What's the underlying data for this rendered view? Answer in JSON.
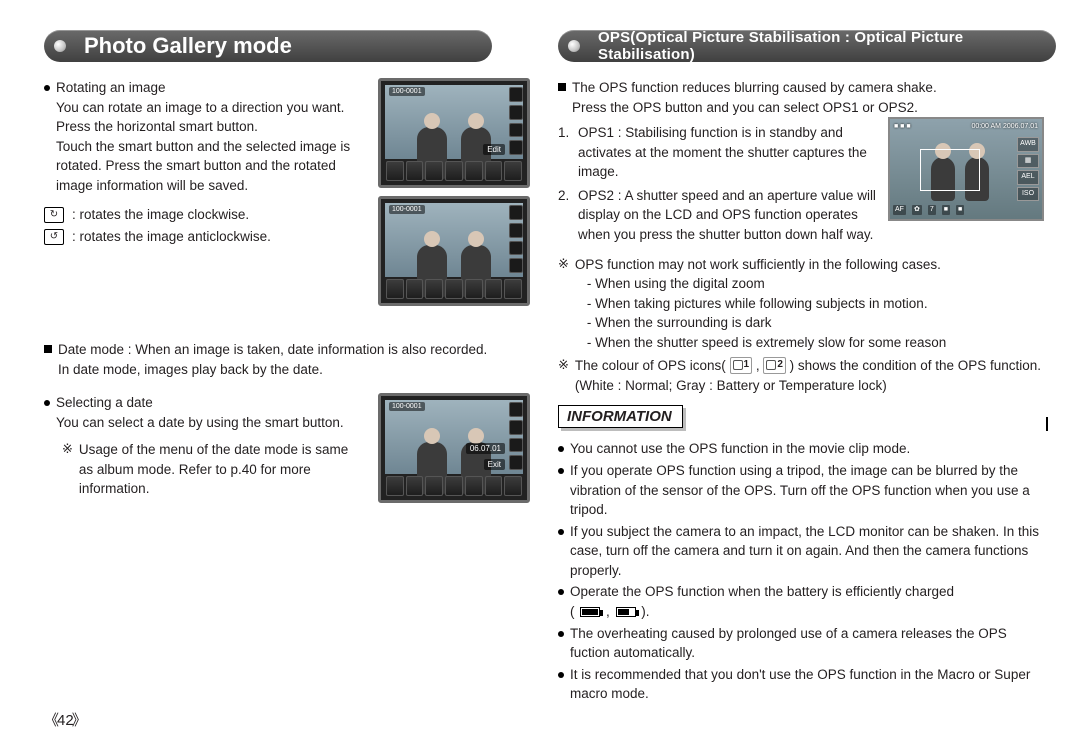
{
  "page_number": "42",
  "left": {
    "header": "Photo Gallery mode",
    "rotating": {
      "title": "Rotating an image",
      "p1": "You can rotate an image to a direction you want.",
      "p2": "Press the horizontal smart button.",
      "p3": "Touch the smart button and the selected image is rotated. Press the smart button and the rotated image information will be saved.",
      "cw": ": rotates the image clockwise.",
      "ccw": ": rotates the image anticlockwise."
    },
    "datemode": {
      "line": "Date mode : When an image is taken, date information is also recorded.",
      "line2": "In date mode, images play back by the date."
    },
    "selecting": {
      "title": "Selecting a date",
      "p1": "You can select a date by using the smart button.",
      "note": "Usage of the menu of the date mode is same as album mode. Refer to p.40 for more information."
    },
    "thumb": {
      "folder": "100-0001",
      "edit": "Edit",
      "date": "06.07.01",
      "exit": "Exit"
    }
  },
  "right": {
    "header": "OPS(Optical Picture Stabilisation : Optical Picture Stabilisation)",
    "intro1": "The OPS function reduces blurring caused by camera shake.",
    "intro2": "Press the OPS button and you can select OPS1 or OPS2.",
    "ops1_num": "1.",
    "ops1": "OPS1 : Stabilising function is in standby and activates at the moment the shutter captures the image.",
    "ops2_num": "2.",
    "ops2": "OPS2 : A shutter speed and an aperture value will display on the LCD and OPS function operates when you press the shutter button down half way.",
    "star1": "OPS function may not work sufficiently in the following cases.",
    "cases": [
      "When using the digital zoom",
      "When taking pictures while following subjects in motion.",
      "When the surrounding is dark",
      "When the shutter speed is extremely slow for some reason"
    ],
    "star2a": "The colour of OPS icons(",
    "star2b": ") shows the condition of the OPS function. (White : Normal; Gray : Battery or Temperature lock)",
    "osd": {
      "time": "00:00 AM 2006.07.01",
      "awb": "AWB",
      "ael": "AEL",
      "af": "AF",
      "iso": "ISO",
      "num": "7"
    },
    "info_header": "INFORMATION",
    "info": [
      "You cannot use the OPS function in the movie clip mode.",
      "If you operate OPS function using a tripod, the image can be blurred by the vibration of the sensor of the OPS. Turn off the OPS function when you use a tripod.",
      "If you subject the camera to an impact, the LCD monitor can be shaken. In this case, turn off the camera and turn it on again. And then the camera functions properly.",
      "Operate the OPS function when the battery is efficiently charged",
      "The overheating caused by prolonged use of a camera releases the OPS fuction automatically.",
      "It is recommended that you don't use the OPS function in the Macro or Super macro mode."
    ],
    "ops_icon1": "1",
    "ops_icon2": "2"
  }
}
